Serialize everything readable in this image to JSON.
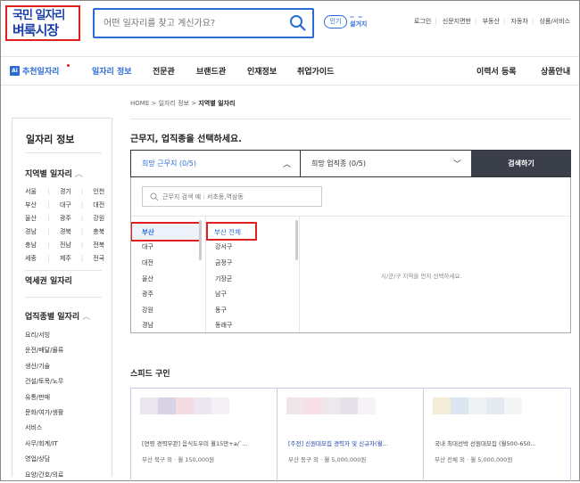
{
  "header": {
    "logo_line1": "국민 일자리",
    "logo_line2": "벼룩시장",
    "search_placeholder": "어떤 일자리를 찾고 계신가요?",
    "popular_badge": "인기",
    "popular_word": "설거지",
    "links": [
      "로그인",
      "신문지면판",
      "부동산",
      "자동차",
      "상품/서비스"
    ]
  },
  "nav": {
    "ai_badge": "Ai",
    "recommend": "추천일자리",
    "items": [
      "일자리 정보",
      "전문관",
      "브랜드관",
      "인재정보",
      "취업가이드"
    ],
    "resume": "이력서 등록",
    "product": "상품안내"
  },
  "sidebar": {
    "title": "일자리 정보",
    "region_title": "지역별 일자리",
    "regions": [
      [
        "서울",
        "경기",
        "인천"
      ],
      [
        "부산",
        "대구",
        "대전"
      ],
      [
        "울산",
        "광주",
        "강원"
      ],
      [
        "경남",
        "경북",
        "충북"
      ],
      [
        "충남",
        "전남",
        "전북"
      ],
      [
        "세종",
        "제주",
        "전국"
      ]
    ],
    "station_title": "역세권 일자리",
    "jobtype_title": "업직종별 일자리",
    "jobtypes": [
      "요리/서빙",
      "운전/배달/물류",
      "생산/기술",
      "건설/토목/노무",
      "유통/판매",
      "문화/여가/생활",
      "서비스",
      "사무/회계/IT",
      "영업/상담",
      "요양/간호/의료"
    ]
  },
  "main": {
    "breadcrumb_home": "HOME",
    "breadcrumb_mid": "일자리 정보",
    "breadcrumb_current": "지역별 일자리",
    "heading": "근무지, 업직종을 선택하세요.",
    "select_location": "희망 근무지 (0/5)",
    "select_jobtype": "희망 업직종 (0/5)",
    "search_button": "검색하기",
    "location_search_placeholder": "근무지 검색 예 : 서초동,역삼동",
    "col1": [
      "부산",
      "대구",
      "대전",
      "울산",
      "광주",
      "강원",
      "경남"
    ],
    "col2": [
      "부산 전체",
      "강서구",
      "금정구",
      "기장군",
      "남구",
      "동구",
      "동래구"
    ],
    "message": "시/군/구 지역을 먼저 선택하세요."
  },
  "speed": {
    "title": "스피드 구인",
    "cards": [
      {
        "title": "[연령 경력무관] 음식도우미 월15만+a/`...",
        "meta": "부산 북구 외 · 월 150,000원"
      },
      {
        "title": "[주전] 신원대모집 경력자 및 신규자(월...",
        "meta": "부산 동구 외 · 월 5,000,000원"
      },
      {
        "title": "국내 최대선박 선원대모집 (월500-650...",
        "meta": "부산 전체 외 · 월 5,000,000원"
      }
    ]
  }
}
